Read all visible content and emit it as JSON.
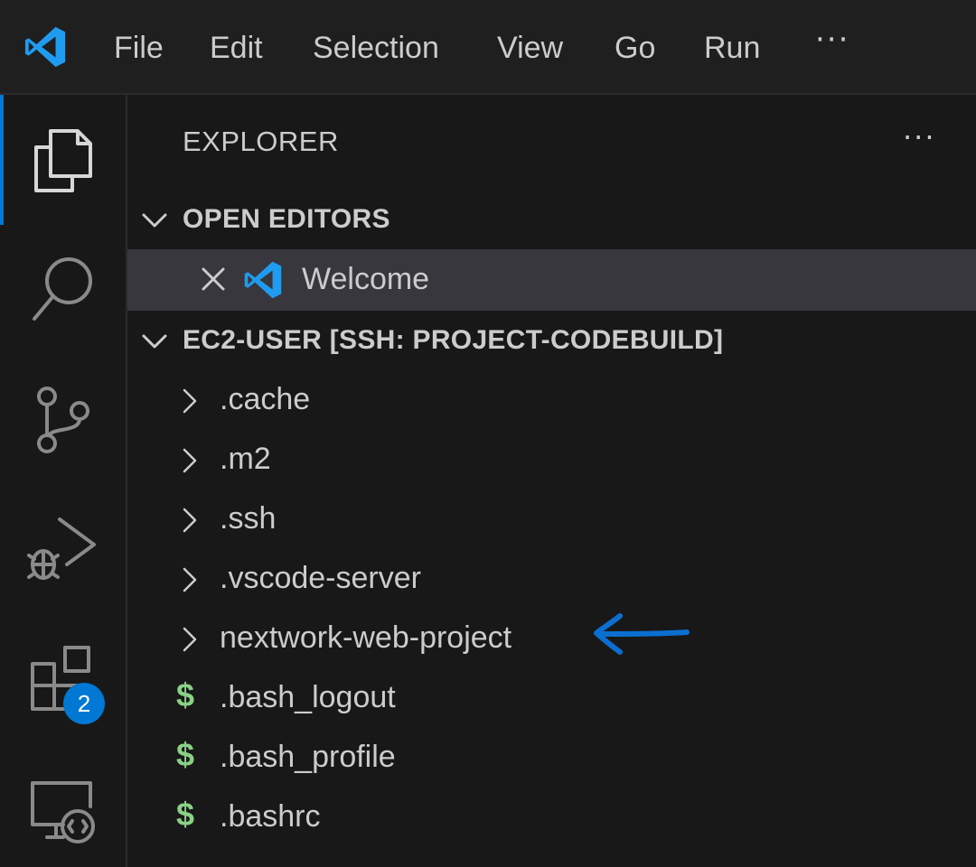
{
  "menu": {
    "items": [
      "File",
      "Edit",
      "Selection",
      "View",
      "Go",
      "Run"
    ],
    "more": "···"
  },
  "activity_bar": {
    "icons": [
      "explorer-icon",
      "search-icon",
      "source-control-icon",
      "run-debug-icon",
      "extensions-icon",
      "remote-explorer-icon"
    ],
    "extensions_badge": "2",
    "accent_color": "#0078d4"
  },
  "sidebar": {
    "title": "EXPLORER",
    "more": "···",
    "open_editors": {
      "header": "OPEN EDITORS",
      "items": [
        {
          "label": "Welcome"
        }
      ]
    },
    "workspace": {
      "header": "EC2-USER [SSH: PROJECT-CODEBUILD]",
      "items": [
        {
          "name": ".cache",
          "kind": "folder"
        },
        {
          "name": ".m2",
          "kind": "folder"
        },
        {
          "name": ".ssh",
          "kind": "folder"
        },
        {
          "name": ".vscode-server",
          "kind": "folder"
        },
        {
          "name": "nextwork-web-project",
          "kind": "folder"
        },
        {
          "name": ".bash_logout",
          "kind": "shell-file"
        },
        {
          "name": ".bash_profile",
          "kind": "shell-file"
        },
        {
          "name": ".bashrc",
          "kind": "shell-file"
        }
      ]
    }
  },
  "colors": {
    "shell_icon": "#89d185",
    "annotation_arrow": "#0a6fd0"
  }
}
